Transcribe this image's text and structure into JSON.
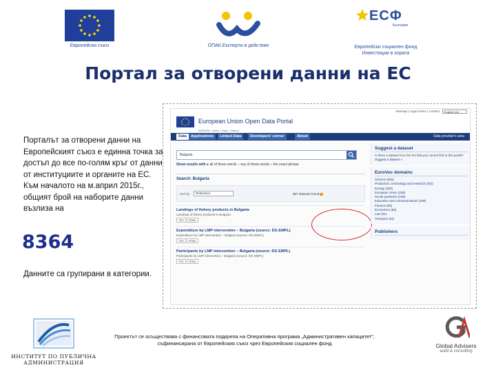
{
  "logos": {
    "eu_caption": "Европейски съюз",
    "opak_caption": "ОПАК.Експерти в действие",
    "esf_mark": "ЕСФ",
    "esf_sub": "България",
    "esf_caption_1": "Европейски социален фонд",
    "esf_caption_2": "Инвестиции в хората",
    "ipa_caption_1": "ИНСТИТУТ ПО ПУБЛИЧНА",
    "ipa_caption_2": "АДМИНИСТРАЦИЯ",
    "ga_name": "Global Advisers",
    "ga_sub": "audit & consulting"
  },
  "title": "Портал за отворени данни на ЕС",
  "intro_text": "Порталът за отворени данни на Европейският съюз е единна точка за достъп до все по-голям кръг от данни от институциите и органите на ЕС. Към началото на м.април 2015г., общият брой на наборите данни възлиза на",
  "dataset_count": "8364",
  "outro_text": "Данните са групирани в категории.",
  "footer_note": "Проектът се осъществява с финансовата подкрепа на Оперативна програма „Административен капацитет“, съфинансирана от Европейския съюз чрез Европейския социален фонд",
  "portal": {
    "util_links": "Sitemap | Legal notice | Contact",
    "lang": "English (en)",
    "name": "European Union Open Data Portal",
    "breadcrumb": "EUROPA › Home › Data › Search",
    "tabs": [
      "Data",
      "Applications",
      "Linked Data",
      "Developers' corner",
      "About"
    ],
    "nav_right": "Data provider's area",
    "search_query": "Bulgaria",
    "show_results": "Show results with",
    "opt_all": "all of these words",
    "opt_any": "any of these words",
    "opt_exact": "the exact phrase",
    "search_heading": "Search: Bulgaria",
    "sort_label": "Sort by",
    "sort_value": "Relevance",
    "datasets_found": "887 datasets found",
    "results": [
      {
        "title": "Landings of fishery products in Bulgaria",
        "desc": "Landings of fishery products in Bulgaria",
        "formats": [
          "TSV",
          "HTML"
        ]
      },
      {
        "title": "Expenditure by LMP intervention – Bulgaria (source: DG EMPL)",
        "desc": "Expenditure by LMP intervention – Bulgaria (source: DG EMPL)",
        "formats": [
          "TSV",
          "HTML"
        ]
      },
      {
        "title": "Participants by LMP intervention – Bulgaria (source: DG EMPL)",
        "desc": "Participants by LMP intervention – Bulgaria (source: DG EMPL)",
        "formats": [
          "TSV",
          "HTML"
        ]
      }
    ],
    "suggest_heading": "Suggest a dataset",
    "suggest_text": "Is there a dataset from the EU that you cannot find in this portal?",
    "suggest_link": "Suggest a dataset »",
    "eurovoc_heading": "EuroVoc domains",
    "eurovoc_items": [
      "Science (283)",
      "Production, technology and research (201)",
      "Energy (200)",
      "European Union (158)",
      "Social questions (159)",
      "Education and communications (108)",
      "Finance (82)",
      "Economics (58)",
      "Law (51)",
      "Transport (51)"
    ],
    "publishers_heading": "Publishers"
  }
}
